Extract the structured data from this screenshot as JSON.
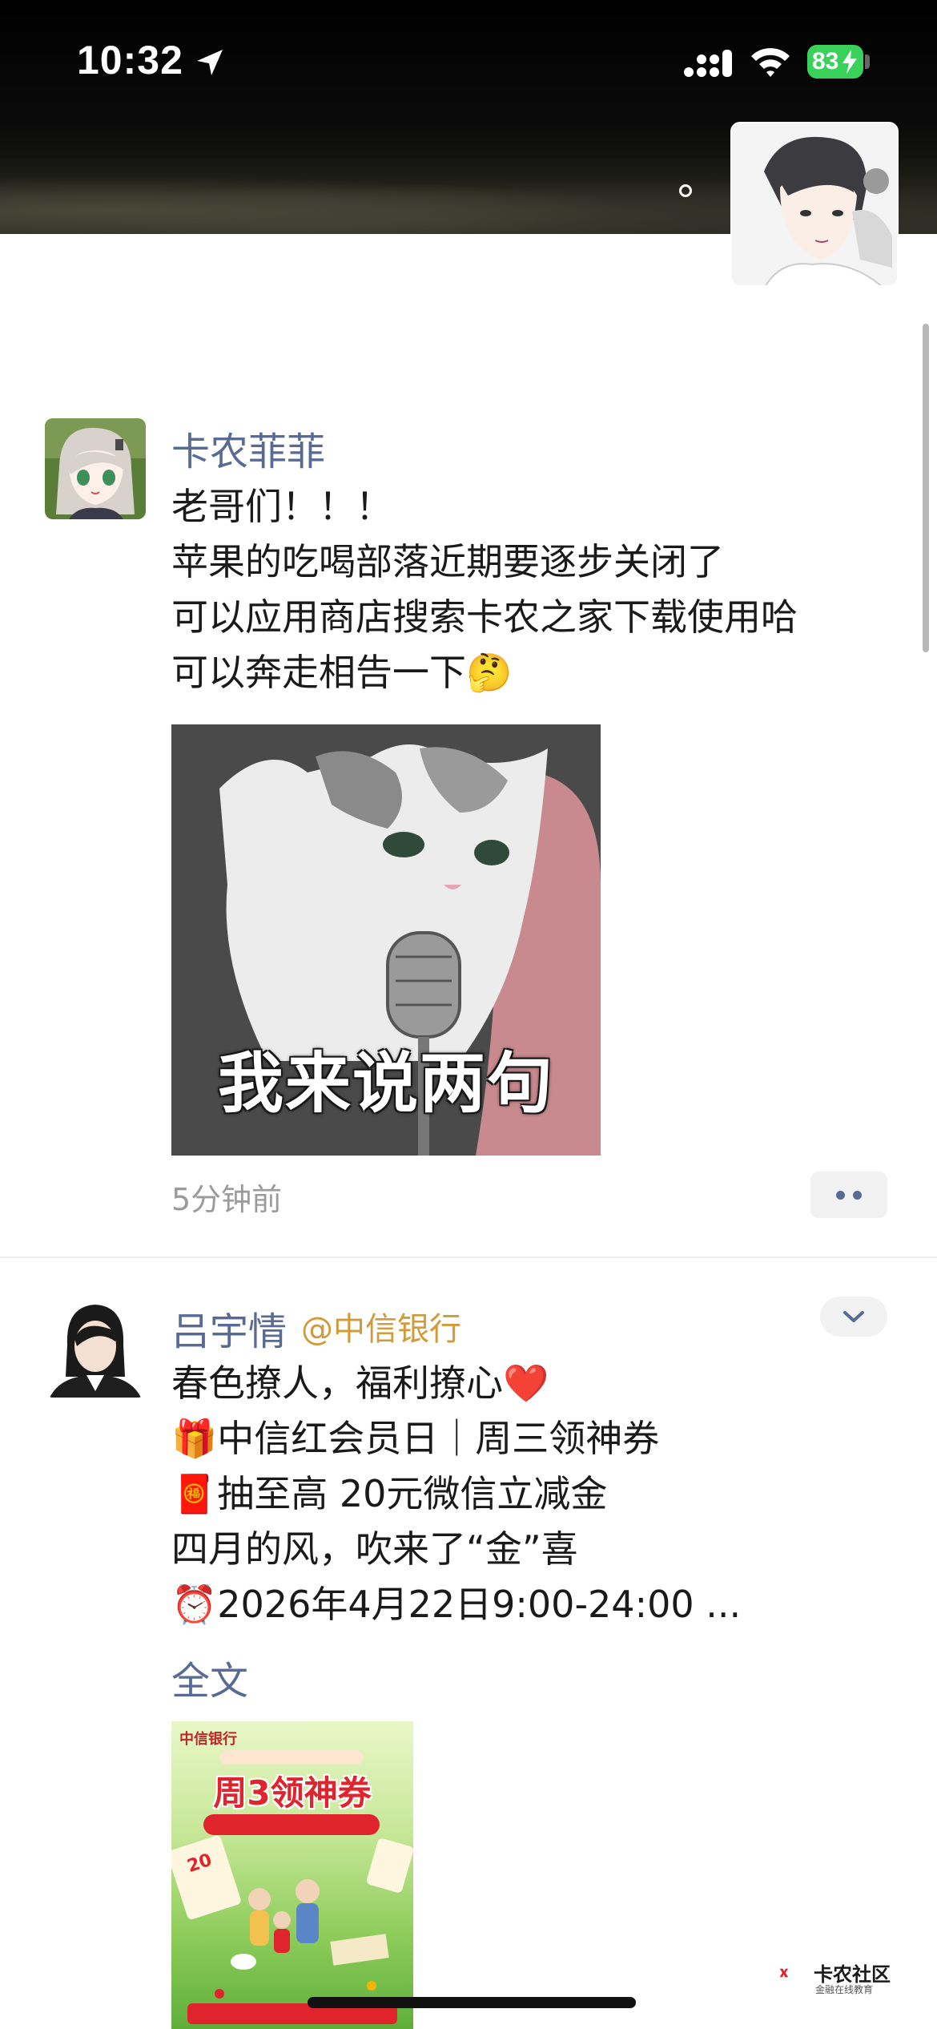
{
  "status_bar": {
    "time": "10:32",
    "battery": "83",
    "colors": {
      "battery": "#3ad15b"
    }
  },
  "theme": {
    "name_color": "#576b95",
    "mention_color": "#d19a3a",
    "time_color": "#9b9b9b"
  },
  "posts": [
    {
      "author": "卡农菲菲",
      "lines": [
        "老哥们！！！",
        "苹果的吃喝部落近期要逐步关闭了",
        "可以应用商店搜索卡农之家下载使用哈",
        "可以奔走相告一下🤔"
      ],
      "image_caption": "我来说两句",
      "time": "5分钟前"
    },
    {
      "author": "吕宇情",
      "mention": "@中信银行",
      "lines": [
        "春色撩人，福利撩心❤️",
        "🎁中信红会员日｜周三领神券",
        "🧧抽至高 20元微信立减金",
        "四月的风，吹来了“金”喜",
        "⏰2026年4月22日9:00-24:00 ..."
      ],
      "full_text_link": "全文",
      "ad_image": {
        "logo": "中信银行",
        "title": "周3领神券"
      }
    }
  ],
  "watermark": {
    "text": "卡农社区",
    "sub": "金融在线教育"
  }
}
